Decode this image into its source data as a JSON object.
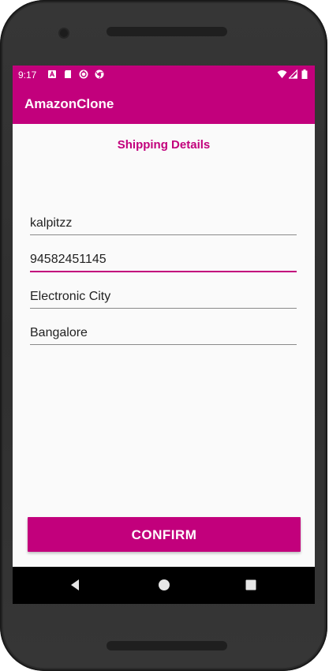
{
  "status_bar": {
    "time": "9:17",
    "left_icons": [
      "a-icon",
      "sd-card-icon",
      "sync-icon",
      "chrome-icon"
    ],
    "right_icons": [
      "wifi-icon",
      "cell-signal-icon",
      "battery-icon"
    ]
  },
  "app_bar": {
    "title": "AmazonClone"
  },
  "form": {
    "title": "Shipping Details",
    "fields": [
      {
        "value": "kalpitzz",
        "focused": false
      },
      {
        "value": "94582451145",
        "focused": true
      },
      {
        "value": "Electronic City",
        "focused": false
      },
      {
        "value": "Bangalore",
        "focused": false
      }
    ],
    "confirm_label": "CONFIRM"
  },
  "nav_bar": {
    "buttons": [
      "back-icon",
      "home-icon",
      "recents-icon"
    ]
  },
  "colors": {
    "accent": "#c2007c",
    "background": "#fafafa",
    "nav_bar": "#000000"
  }
}
